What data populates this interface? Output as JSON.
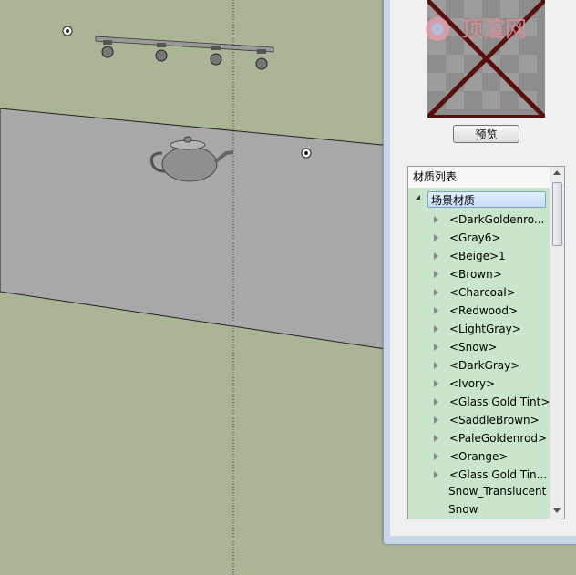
{
  "window": {
    "preview_button_label": "预览",
    "watermark_text": "顶渲网"
  },
  "material_list": {
    "header": "材质列表",
    "root_label": "场景材质",
    "items": [
      {
        "label": "<DarkGoldenro..."
      },
      {
        "label": "<Gray6>"
      },
      {
        "label": "<Beige>1"
      },
      {
        "label": "<Brown>"
      },
      {
        "label": "<Charcoal>"
      },
      {
        "label": "<Redwood>"
      },
      {
        "label": "<LightGray>"
      },
      {
        "label": "<Snow>"
      },
      {
        "label": "<DarkGray>"
      },
      {
        "label": "<Ivory>"
      },
      {
        "label": "<Glass Gold Tint>"
      },
      {
        "label": "<SaddleBrown>"
      },
      {
        "label": "<PaleGoldenrod>"
      },
      {
        "label": "<Orange>"
      },
      {
        "label": "<Glass Gold Tin..."
      },
      {
        "label": "Snow_Translucent"
      },
      {
        "label": "Snow"
      }
    ]
  },
  "colors": {
    "viewport_background": "#a9b594",
    "ground_plane": "#a9a8a8",
    "list_highlight": "#c9e5cb",
    "preview_cross": "#5a0f0f"
  }
}
